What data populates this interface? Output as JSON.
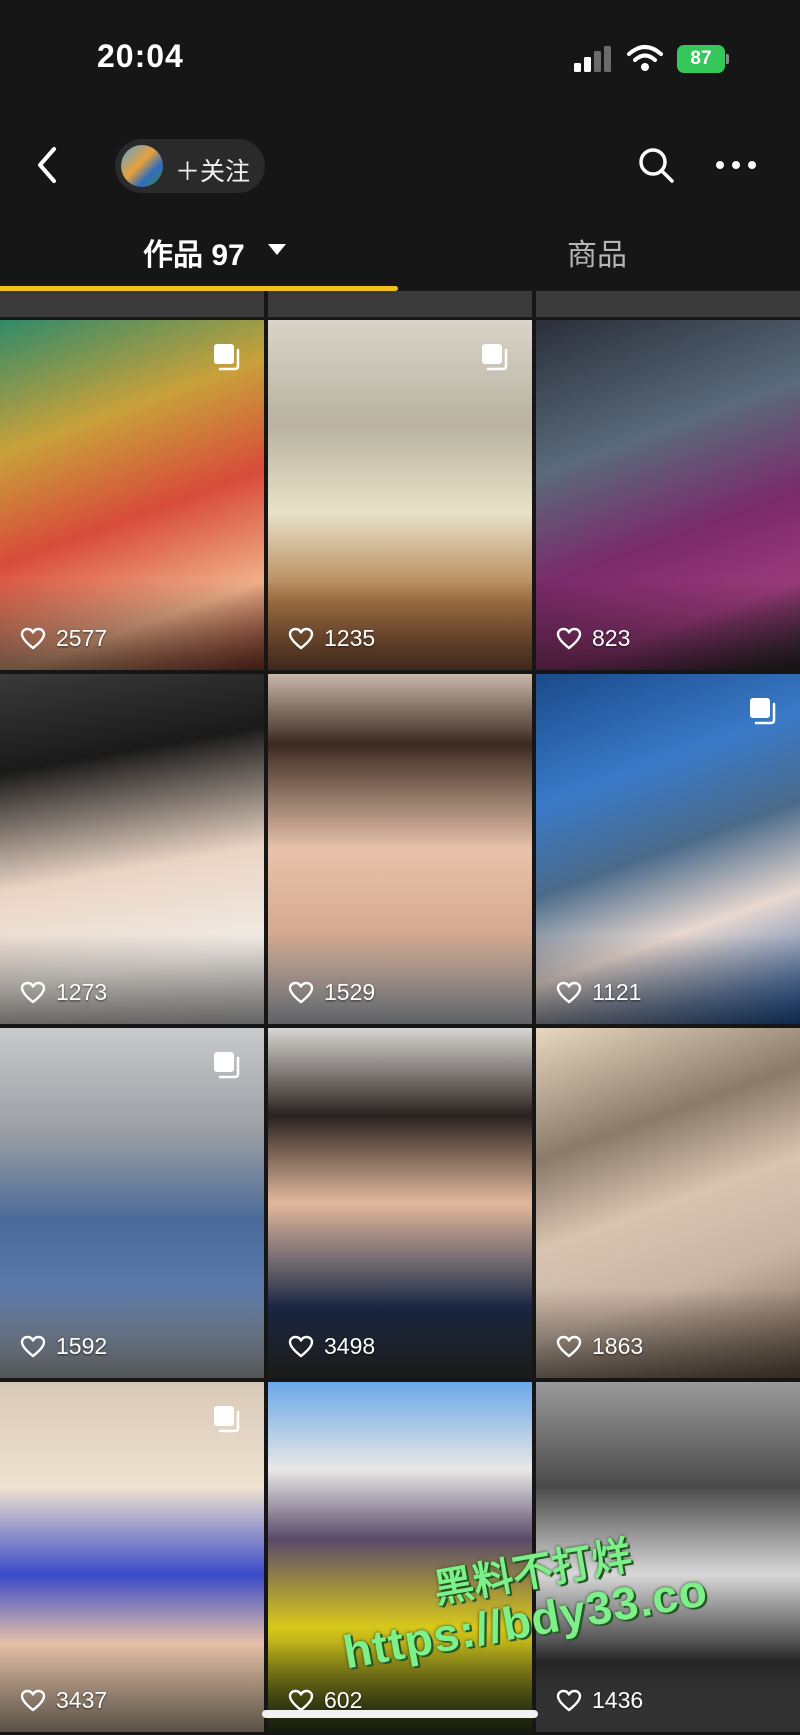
{
  "status_bar": {
    "time": "20:04",
    "battery": "87",
    "icons": [
      "signal-icon",
      "wifi-icon",
      "battery-charging-icon"
    ]
  },
  "nav": {
    "follow_label": "＋关注",
    "icons": [
      "back-icon",
      "search-icon",
      "more-icon"
    ]
  },
  "tabs": [
    {
      "label": "作品 97",
      "active": true
    },
    {
      "label": "商品",
      "active": false
    }
  ],
  "posts": [
    {
      "likes": "2577",
      "multi": true
    },
    {
      "likes": "1235",
      "multi": true
    },
    {
      "likes": "823",
      "multi": false
    },
    {
      "likes": "1273",
      "multi": false
    },
    {
      "likes": "1529",
      "multi": false
    },
    {
      "likes": "1121",
      "multi": true
    },
    {
      "likes": "1592",
      "multi": true
    },
    {
      "likes": "3498",
      "multi": false
    },
    {
      "likes": "1863",
      "multi": false
    },
    {
      "likes": "3437",
      "multi": true
    },
    {
      "likes": "602",
      "multi": false
    },
    {
      "likes": "1436",
      "multi": false
    }
  ],
  "watermark": {
    "line1": "黑料不打烊",
    "line2": "https://bdy33.co"
  },
  "colors": {
    "background": "#161616",
    "tab_indicator": "#f2c21a",
    "battery": "#35c759",
    "watermark": "#7ef08a"
  }
}
